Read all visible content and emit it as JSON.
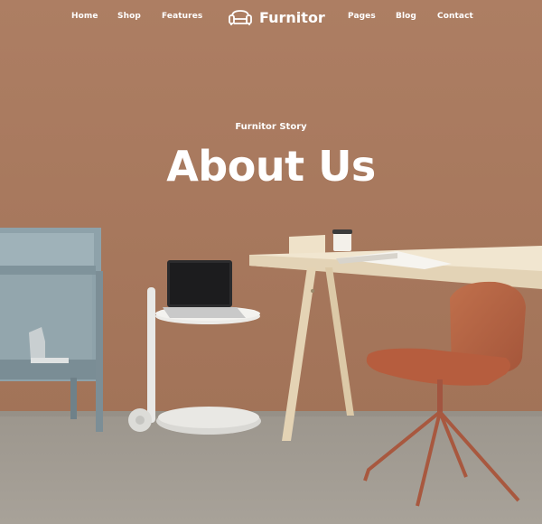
{
  "nav": {
    "left_items": [
      {
        "label": "Home"
      },
      {
        "label": "Shop"
      },
      {
        "label": "Features"
      }
    ],
    "brand": {
      "name": "Furnitor",
      "icon": "sofa-icon"
    },
    "right_items": [
      {
        "label": "Pages"
      },
      {
        "label": "Blog"
      },
      {
        "label": "Contact"
      }
    ]
  },
  "hero": {
    "kicker": "Furnitor Story",
    "title": "About Us"
  },
  "colors": {
    "wall": "#a97a60",
    "floor": "#a29c93",
    "text": "#ffffff",
    "chair": "#b5603f",
    "shelf": "#8b9ea6"
  }
}
